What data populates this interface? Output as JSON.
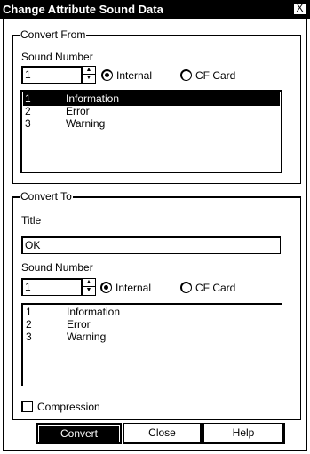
{
  "window": {
    "title": "Change Attribute Sound Data",
    "close_glyph": "X"
  },
  "convert_from": {
    "group_label": "Convert From",
    "sound_number_label": "Sound Number",
    "sound_number_value": "1",
    "radio_internal_label": "Internal",
    "radio_cf_card_label": "CF Card",
    "selected_source": "Internal",
    "list": [
      {
        "num": "1",
        "name": "Information",
        "selected": true
      },
      {
        "num": "2",
        "name": "Error",
        "selected": false
      },
      {
        "num": "3",
        "name": "Warning",
        "selected": false
      }
    ]
  },
  "convert_to": {
    "group_label": "Convert To",
    "title_label": "Title",
    "title_value": "OK",
    "sound_number_label": "Sound Number",
    "sound_number_value": "1",
    "radio_internal_label": "Internal",
    "radio_cf_card_label": "CF Card",
    "selected_source": "Internal",
    "list": [
      {
        "num": "1",
        "name": "Information"
      },
      {
        "num": "2",
        "name": "Error"
      },
      {
        "num": "3",
        "name": "Warning"
      }
    ],
    "compression_label": "Compression",
    "compression_checked": false
  },
  "buttons": {
    "convert": "Convert",
    "close": "Close",
    "help": "Help"
  }
}
